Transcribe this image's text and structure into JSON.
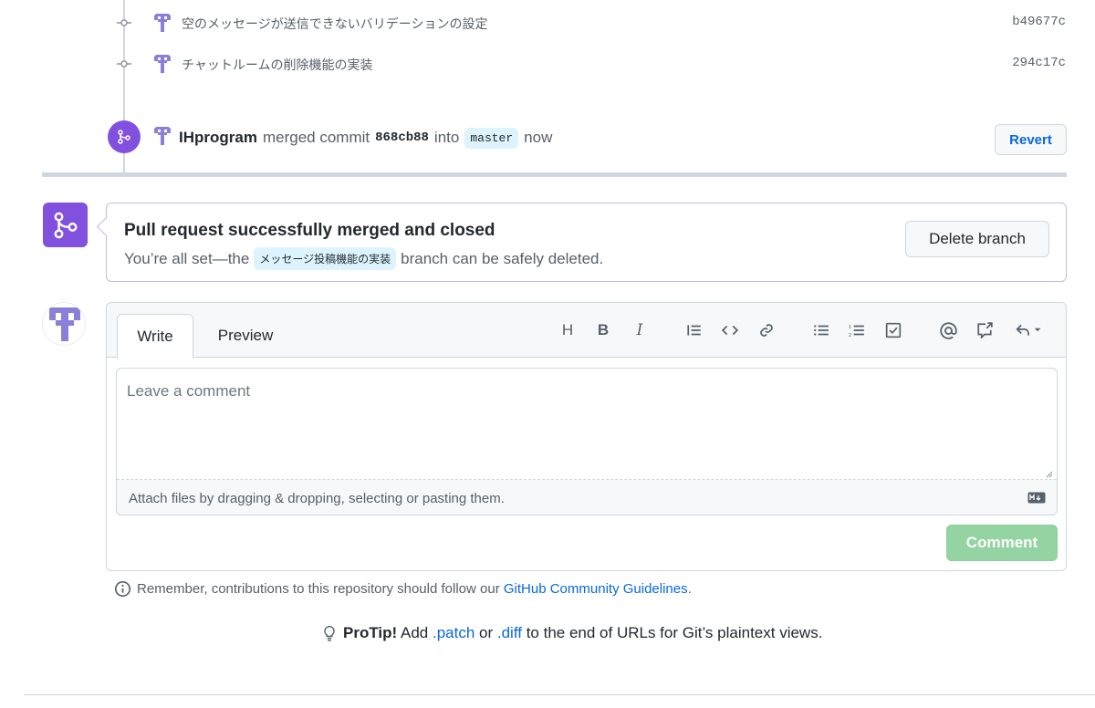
{
  "commits": [
    {
      "message": "空のメッセージが送信できないバリデーションの設定",
      "sha": "b49677c"
    },
    {
      "message": "チャットルームの削除機能の実装",
      "sha": "294c17c"
    }
  ],
  "merge_event": {
    "user": "IHprogram",
    "text1": "merged commit",
    "sha": "868cb88",
    "text2": "into",
    "branch": "master",
    "time": "now",
    "revert_label": "Revert"
  },
  "merged_box": {
    "title": "Pull request successfully merged and closed",
    "sub_prefix": "You’re all set—the",
    "branch": "メッセージ投稿機能の実装",
    "sub_suffix": "branch can be safely deleted.",
    "delete_label": "Delete branch"
  },
  "comment": {
    "tab_write": "Write",
    "tab_preview": "Preview",
    "placeholder": "Leave a comment",
    "attach_text": "Attach files by dragging & dropping, selecting or pasting them.",
    "submit_label": "Comment",
    "toolbar": {
      "heading": "H",
      "bold": "B",
      "italic": "I"
    }
  },
  "remember": {
    "prefix": "Remember, contributions to this repository should follow our",
    "link": "GitHub Community Guidelines",
    "suffix": "."
  },
  "protip": {
    "bold": "ProTip!",
    "t1": "Add",
    "link1": ".patch",
    "t2": "or",
    "link2": ".diff",
    "t3": "to the end of URLs for Git’s plaintext views."
  },
  "colors": {
    "merged_purple": "#8250df",
    "link_blue": "#0969da",
    "comment_green_disabled": "#94d3a2"
  }
}
